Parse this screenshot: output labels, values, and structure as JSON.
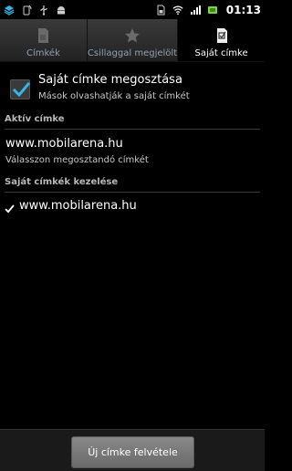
{
  "status_bar": {
    "time": "01:13",
    "icons": [
      "stack-icon",
      "phone-signal-icon",
      "usb-icon",
      "android-icon",
      "sim-icon",
      "wifi-icon",
      "network-icon",
      "battery-icon"
    ]
  },
  "tabs": [
    {
      "label": "Címkék",
      "icon": "tag-icon",
      "active": false
    },
    {
      "label": "Csillaggal megjelölt",
      "icon": "star-icon",
      "active": false
    },
    {
      "label": "Saját címke",
      "icon": "own-tag-icon",
      "active": true
    }
  ],
  "share": {
    "title": "Saját címke megosztása",
    "subtitle": "Mások olvashatják a saját címkét",
    "checked": true
  },
  "active_tag": {
    "section_label": "Aktív címke",
    "value": "www.mobilarena.hu",
    "hint": "Válasszon megosztandó címkét"
  },
  "manage": {
    "section_label": "Saját címkék kezelése",
    "items": [
      {
        "label": "www.mobilarena.hu",
        "checked": true
      }
    ]
  },
  "bottom": {
    "add_button_label": "Új címke felvétele"
  },
  "colors": {
    "accent": "#33b5e5",
    "background": "#000000"
  }
}
